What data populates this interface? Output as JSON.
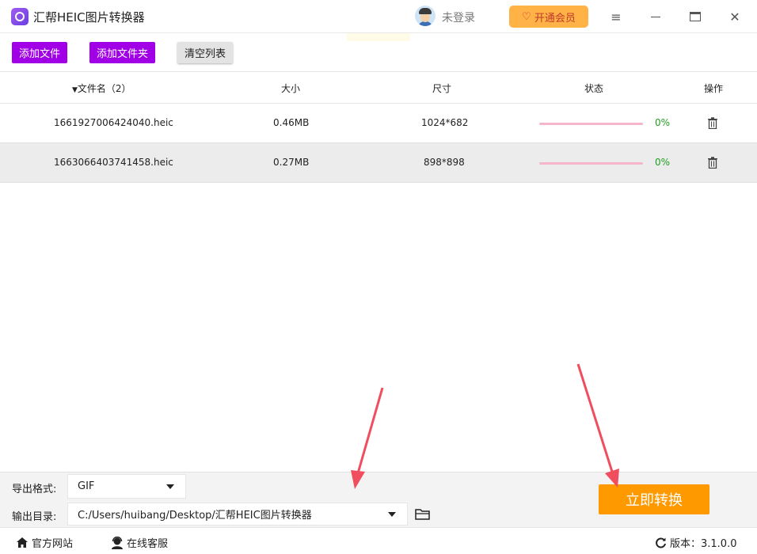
{
  "app": {
    "title": "汇帮HEIC图片转换器",
    "login": "未登录",
    "vip_label": "开通会员"
  },
  "toolbar": {
    "add_file": "添加文件",
    "add_folder": "添加文件夹",
    "clear_list": "清空列表"
  },
  "table": {
    "headers": {
      "filename": "文件名（2）",
      "size": "大小",
      "dimensions": "尺寸",
      "status": "状态",
      "action": "操作"
    },
    "rows": [
      {
        "filename": "1661927006424040.heic",
        "size": "0.46MB",
        "dimensions": "1024*682",
        "progress": 0,
        "progress_text": "0%"
      },
      {
        "filename": "1663066403741458.heic",
        "size": "0.27MB",
        "dimensions": "898*898",
        "progress": 0,
        "progress_text": "0%"
      }
    ]
  },
  "settings": {
    "format_label": "导出格式:",
    "format_value": "GIF",
    "output_label": "输出目录:",
    "output_value": "C:/Users/huibang/Desktop/汇帮HEIC图片转换器",
    "convert_label": "立即转换"
  },
  "footer": {
    "website": "官方网站",
    "support": "在线客服",
    "version": "版本：3.1.0.0"
  },
  "colors": {
    "accent_purple": "#a100e6",
    "convert_orange": "#ff9900",
    "vip_orange": "#ffb347",
    "progress_pink": "#f4b6c8",
    "percent_green": "#1f9e1f",
    "annotation_red": "#f04e5e"
  },
  "icons": [
    "app-logo-icon",
    "user-avatar-icon",
    "heart-icon",
    "menu-icon",
    "minimize-icon",
    "maximize-icon",
    "close-icon",
    "sort-caret-icon",
    "trash-icon",
    "dropdown-caret-icon",
    "folder-icon",
    "home-icon",
    "headset-icon",
    "refresh-icon"
  ]
}
